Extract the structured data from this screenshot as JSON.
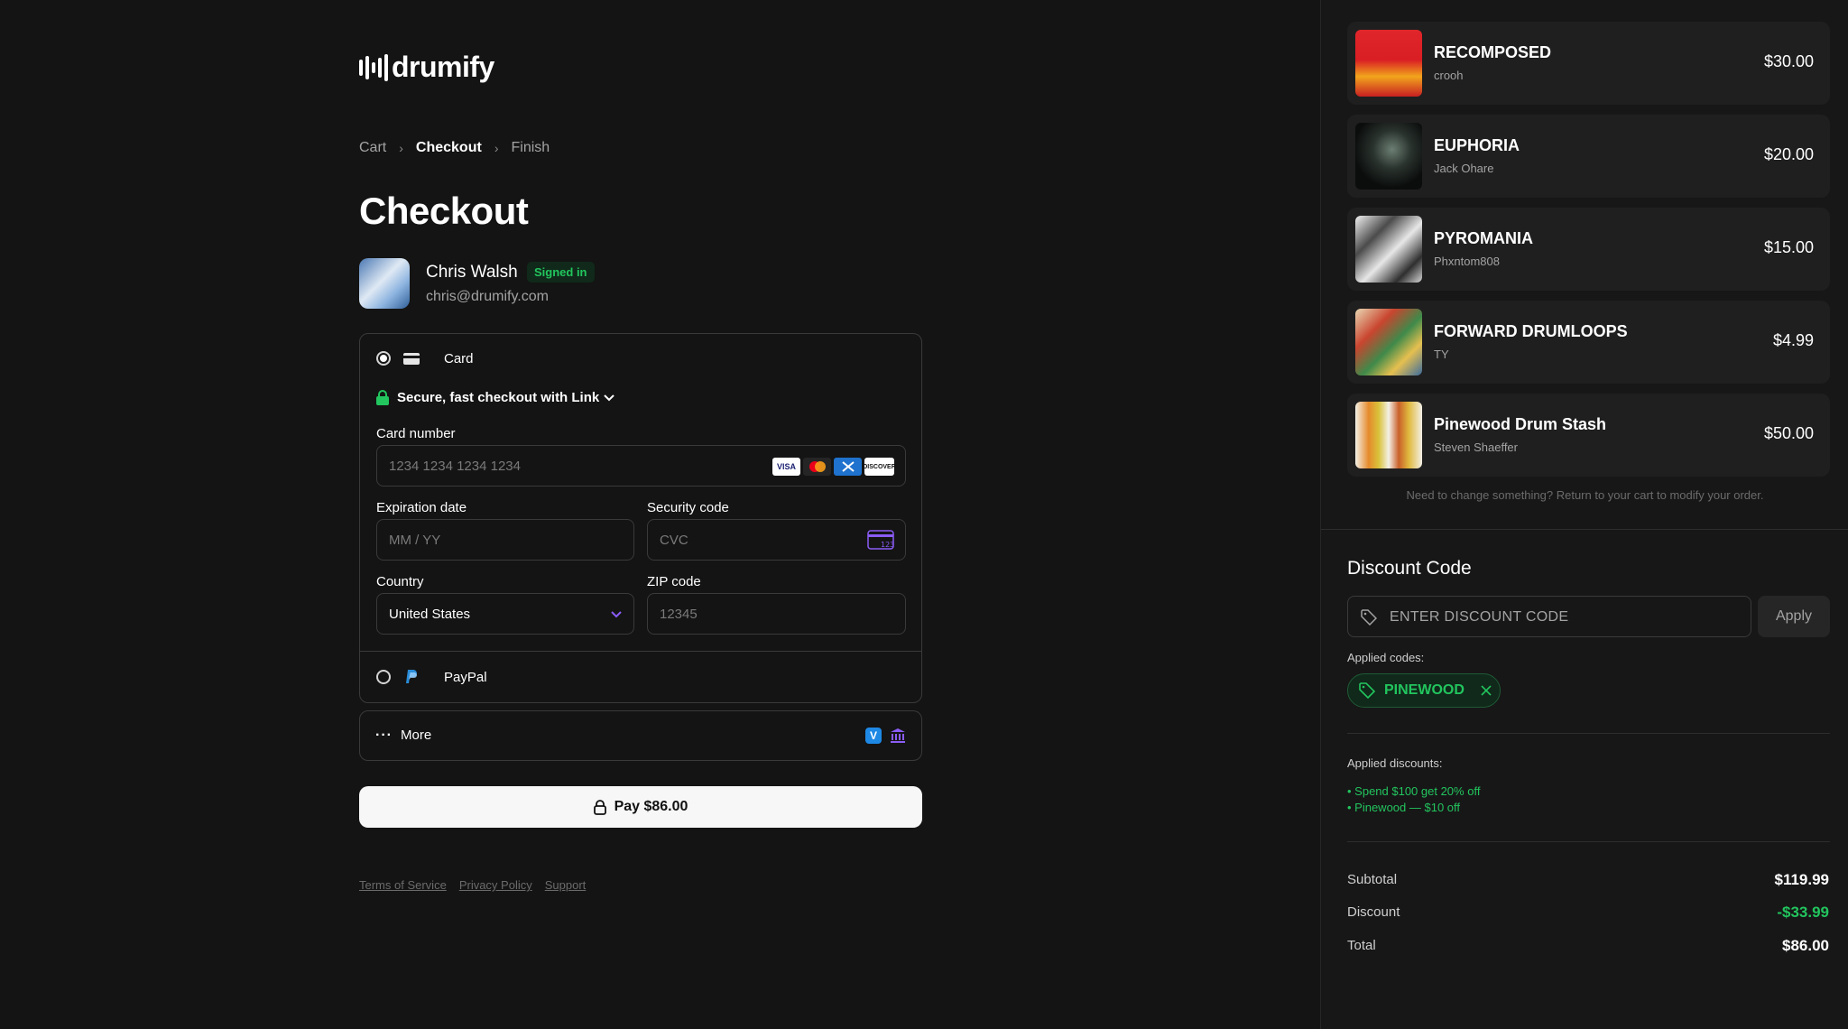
{
  "brand": {
    "name": "drumify"
  },
  "breadcrumb": {
    "items": [
      "Cart",
      "Checkout",
      "Finish"
    ]
  },
  "page": {
    "title": "Checkout"
  },
  "user": {
    "name": "Chris Walsh",
    "status": "Signed in",
    "email": "chris@drumify.com"
  },
  "payment": {
    "card_label": "Card",
    "link_text": "Secure, fast checkout with Link",
    "card_number_label": "Card number",
    "card_number_placeholder": "1234 1234 1234 1234",
    "card_brands": [
      "VISA",
      "mastercard-icon",
      "amex-icon",
      "DISCOVER"
    ],
    "expiration_label": "Expiration date",
    "expiration_placeholder": "MM / YY",
    "security_label": "Security code",
    "security_placeholder": "CVC",
    "cvc_icon_text": "123",
    "country_label": "Country",
    "country_value": "United States",
    "zip_label": "ZIP code",
    "zip_placeholder": "12345",
    "paypal_label": "PayPal",
    "more_label": "More",
    "pay_button": "Pay $86.00"
  },
  "footer": {
    "links": [
      "Terms of Service",
      "Privacy Policy",
      "Support"
    ]
  },
  "cart": {
    "items": [
      {
        "title": "RECOMPOSED",
        "artist": "crooh",
        "price": "$30.00"
      },
      {
        "title": "EUPHORIA",
        "artist": "Jack Ohare",
        "price": "$20.00"
      },
      {
        "title": "PYROMANIA",
        "artist": "Phxntom808",
        "price": "$15.00"
      },
      {
        "title": "FORWARD DRUMLOOPS",
        "artist": "TY",
        "price": "$4.99"
      },
      {
        "title": "Pinewood Drum Stash",
        "artist": "Steven Shaeffer",
        "price": "$50.00"
      }
    ],
    "note": "Need to change something? Return to your cart to modify your order."
  },
  "discount": {
    "title": "Discount Code",
    "placeholder": "ENTER DISCOUNT CODE",
    "apply_label": "Apply",
    "applied_codes_label": "Applied codes:",
    "applied_code": "PINEWOOD",
    "applied_discounts_label": "Applied discounts:",
    "discount_lines": [
      "• Spend $100 get 20% off",
      "• Pinewood — $10 off"
    ]
  },
  "summary": {
    "subtotal_label": "Subtotal",
    "subtotal_value": "$119.99",
    "discount_label": "Discount",
    "discount_value": "-$33.99",
    "total_label": "Total",
    "total_value": "$86.00"
  },
  "colors": {
    "accent_green": "#22c55e",
    "background": "#141414",
    "panel": "#171717"
  }
}
